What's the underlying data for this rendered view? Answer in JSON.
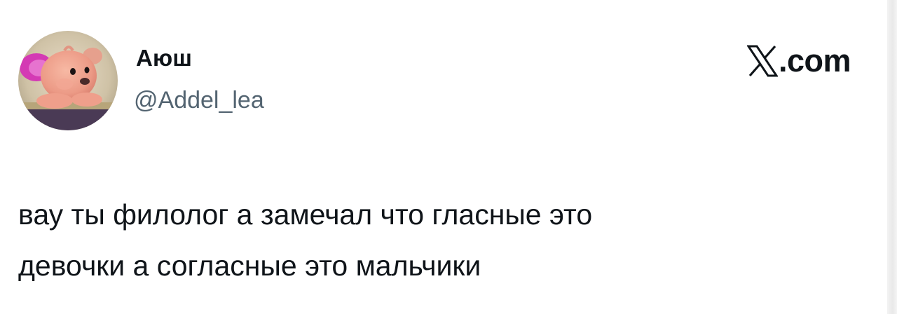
{
  "author": {
    "display_name": "Аюш",
    "handle": "@Addel_lea",
    "avatar_description": "pink cartoon bear avatar"
  },
  "brand": {
    "icon": "x-logo-icon",
    "suffix": ".com"
  },
  "tweet": {
    "lines": [
      "вау ты филолог а замечал что гласные это",
      "девочки а согласные это мальчики"
    ]
  },
  "colors": {
    "text_primary": "#0f1419",
    "text_secondary": "#536471",
    "background": "#ffffff"
  }
}
